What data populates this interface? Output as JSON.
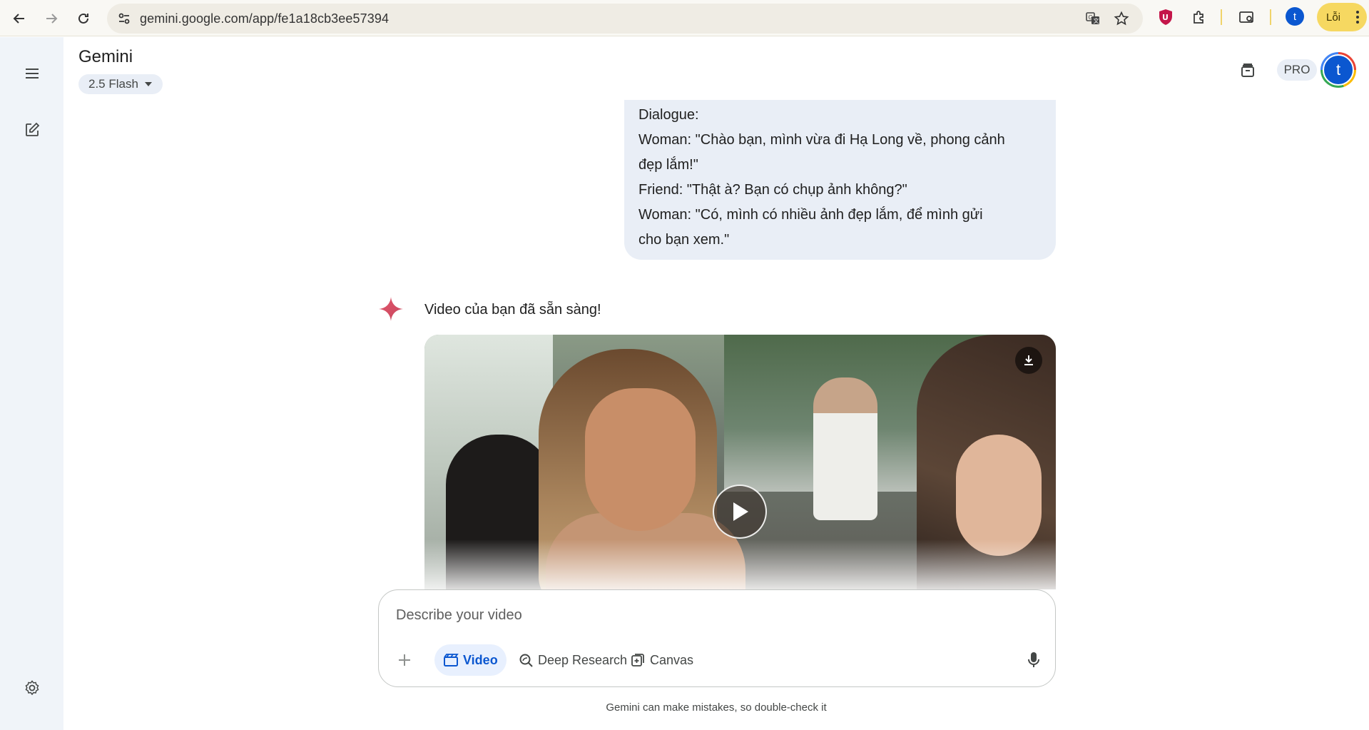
{
  "browser": {
    "url": "gemini.google.com/app/fe1a18cb3ee57394",
    "profile_initial": "t",
    "error_label": "Lỗi"
  },
  "header": {
    "title": "Gemini",
    "model": "2.5 Flash",
    "pro_label": "PRO",
    "avatar_initial": "t"
  },
  "chat": {
    "user_message_lines": [
      "Dialogue:",
      "Woman: \"Chào bạn, mình vừa đi Hạ Long về, phong cảnh",
      "đẹp lắm!\"",
      "Friend: \"Thật à? Bạn có chụp ảnh không?\"",
      "Woman: \"Có, mình có nhiều ảnh đẹp lắm, để mình gửi",
      "cho bạn xem.\""
    ],
    "reply_text": "Video của bạn đã sẵn sàng!"
  },
  "composer": {
    "placeholder": "Describe your video",
    "tools": [
      {
        "label": "Video",
        "active": true
      },
      {
        "label": "Deep Research",
        "active": false
      },
      {
        "label": "Canvas",
        "active": false
      }
    ]
  },
  "footer": {
    "disclaimer": "Gemini can make mistakes, so double-check it"
  },
  "colors": {
    "accent": "#0b57d0",
    "rail_bg": "#f0f4f9",
    "bubble_bg": "#e9eef6"
  }
}
